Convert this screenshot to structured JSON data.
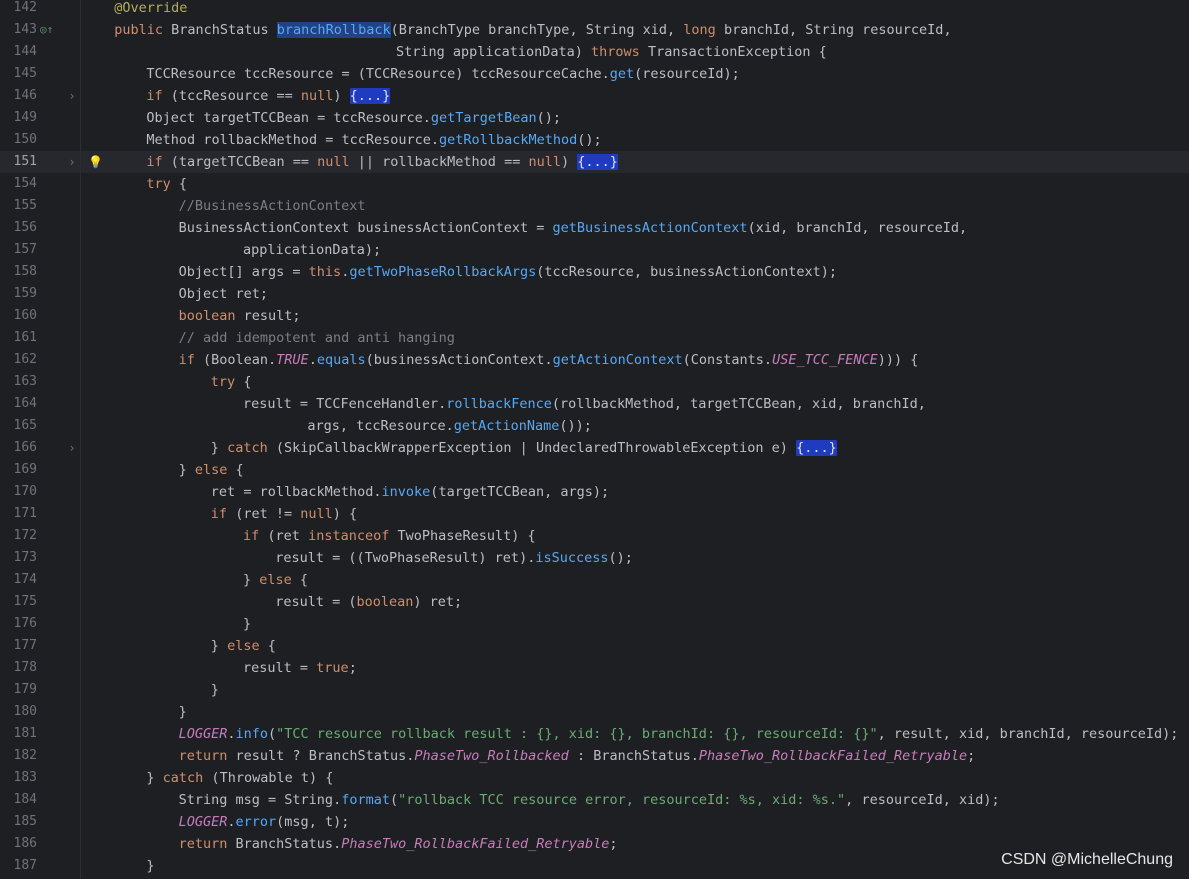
{
  "editor": {
    "lines": [
      {
        "num": "142",
        "indent": 4,
        "code": "@Override",
        "kind": "annotation"
      },
      {
        "num": "143",
        "indent": 4,
        "code": "public BranchStatus branchRollback(BranchType branchType, String xid, long branchId, String resourceId,",
        "marker": "override-marker",
        "kind": "signature"
      },
      {
        "num": "144",
        "indent": 39,
        "code": "String applicationData) throws TransactionException {",
        "kind": "signature2"
      },
      {
        "num": "145",
        "indent": 8,
        "code": "TCCResource tccResource = (TCCResource) tccResourceCache.get(resourceId);"
      },
      {
        "num": "146",
        "indent": 8,
        "code": "if (tccResource == null) {...}",
        "fold": true
      },
      {
        "num": "149",
        "indent": 8,
        "code": "Object targetTCCBean = tccResource.getTargetBean();"
      },
      {
        "num": "150",
        "indent": 8,
        "code": "Method rollbackMethod = tccResource.getRollbackMethod();"
      },
      {
        "num": "151",
        "indent": 8,
        "code": "if (targetTCCBean == null || rollbackMethod == null) {...}",
        "fold": true,
        "bulb": true,
        "current": true
      },
      {
        "num": "154",
        "indent": 8,
        "code": "try {"
      },
      {
        "num": "155",
        "indent": 12,
        "code": "//BusinessActionContext",
        "kind": "comment"
      },
      {
        "num": "156",
        "indent": 12,
        "code": "BusinessActionContext businessActionContext = getBusinessActionContext(xid, branchId, resourceId,"
      },
      {
        "num": "157",
        "indent": 20,
        "code": "applicationData);"
      },
      {
        "num": "158",
        "indent": 12,
        "code": "Object[] args = this.getTwoPhaseRollbackArgs(tccResource, businessActionContext);"
      },
      {
        "num": "159",
        "indent": 12,
        "code": "Object ret;"
      },
      {
        "num": "160",
        "indent": 12,
        "code": "boolean result;"
      },
      {
        "num": "161",
        "indent": 12,
        "code": "// add idempotent and anti hanging",
        "kind": "comment"
      },
      {
        "num": "162",
        "indent": 12,
        "code": "if (Boolean.TRUE.equals(businessActionContext.getActionContext(Constants.USE_TCC_FENCE))) {"
      },
      {
        "num": "163",
        "indent": 16,
        "code": "try {"
      },
      {
        "num": "164",
        "indent": 20,
        "code": "result = TCCFenceHandler.rollbackFence(rollbackMethod, targetTCCBean, xid, branchId,"
      },
      {
        "num": "165",
        "indent": 28,
        "code": "args, tccResource.getActionName());"
      },
      {
        "num": "166",
        "indent": 16,
        "code": "} catch (SkipCallbackWrapperException | UndeclaredThrowableException e) {...}",
        "fold": true
      },
      {
        "num": "169",
        "indent": 12,
        "code": "} else {"
      },
      {
        "num": "170",
        "indent": 16,
        "code": "ret = rollbackMethod.invoke(targetTCCBean, args);"
      },
      {
        "num": "171",
        "indent": 16,
        "code": "if (ret != null) {"
      },
      {
        "num": "172",
        "indent": 20,
        "code": "if (ret instanceof TwoPhaseResult) {"
      },
      {
        "num": "173",
        "indent": 24,
        "code": "result = ((TwoPhaseResult) ret).isSuccess();"
      },
      {
        "num": "174",
        "indent": 20,
        "code": "} else {"
      },
      {
        "num": "175",
        "indent": 24,
        "code": "result = (boolean) ret;"
      },
      {
        "num": "176",
        "indent": 20,
        "code": "}"
      },
      {
        "num": "177",
        "indent": 16,
        "code": "} else {"
      },
      {
        "num": "178",
        "indent": 20,
        "code": "result = true;"
      },
      {
        "num": "179",
        "indent": 16,
        "code": "}"
      },
      {
        "num": "180",
        "indent": 12,
        "code": "}"
      },
      {
        "num": "181",
        "indent": 12,
        "code": "LOGGER.info(\"TCC resource rollback result : {}, xid: {}, branchId: {}, resourceId: {}\", result, xid, branchId, resourceId);"
      },
      {
        "num": "182",
        "indent": 12,
        "code": "return result ? BranchStatus.PhaseTwo_Rollbacked : BranchStatus.PhaseTwo_RollbackFailed_Retryable;"
      },
      {
        "num": "183",
        "indent": 8,
        "code": "} catch (Throwable t) {"
      },
      {
        "num": "184",
        "indent": 12,
        "code": "String msg = String.format(\"rollback TCC resource error, resourceId: %s, xid: %s.\", resourceId, xid);"
      },
      {
        "num": "185",
        "indent": 12,
        "code": "LOGGER.error(msg, t);"
      },
      {
        "num": "186",
        "indent": 12,
        "code": "return BranchStatus.PhaseTwo_RollbackFailed_Retryable;"
      },
      {
        "num": "187",
        "indent": 8,
        "code": "}"
      }
    ]
  },
  "icons": {
    "fold": "chevron-right-icon",
    "bulb": "lightbulb-icon",
    "marker": "override-marker-icon"
  },
  "glyphs": {
    "fold": "›",
    "bulb": "💡",
    "marker": "◎↑"
  },
  "colors": {
    "background": "#1e1f22",
    "keyword": "#cf8e6d",
    "string": "#6aab73",
    "function": "#56a8f5",
    "static_field": "#c77dbb",
    "fold_block": "#1f3bbf",
    "selection": "#214283"
  },
  "watermark": "CSDN @MichelleChung"
}
